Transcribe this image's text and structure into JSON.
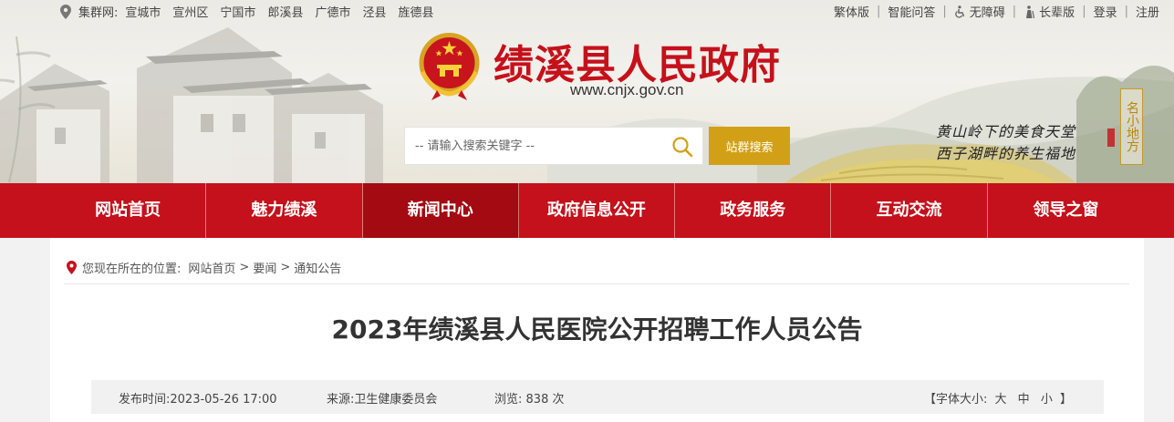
{
  "topbar": {
    "county_label": "集群网:",
    "counties": [
      "宣城市",
      "宣州区",
      "宁国市",
      "郎溪县",
      "广德市",
      "泾县",
      "旌德县"
    ],
    "links": {
      "traditional": "繁体版",
      "smart_qa": "智能问答",
      "accessibility": "无障碍",
      "elder": "长辈版",
      "login": "登录",
      "register": "注册"
    }
  },
  "header": {
    "title": "绩溪县人民政府",
    "url": "www.cnjx.gov.cn",
    "slogan_line1": "黄山岭下的美食天堂",
    "slogan_line2": "西子湖畔的养生福地",
    "seal_text": "名小地方"
  },
  "search": {
    "placeholder": "-- 请输入搜索关键字 --",
    "button_label": "站群搜索"
  },
  "nav": {
    "items": [
      {
        "label": "网站首页"
      },
      {
        "label": "魅力绩溪"
      },
      {
        "label": "新闻中心"
      },
      {
        "label": "政府信息公开"
      },
      {
        "label": "政务服务"
      },
      {
        "label": "互动交流"
      },
      {
        "label": "领导之窗"
      }
    ],
    "active_index": 2
  },
  "breadcrumb": {
    "prefix": "您现在所在的位置:",
    "items": [
      "网站首页",
      "要闻",
      "通知公告"
    ],
    "separator": ">"
  },
  "article": {
    "title": "2023年绩溪县人民医院公开招聘工作人员公告",
    "publish_label": "发布时间:",
    "publish_time": "2023-05-26 17:00",
    "source_label": "来源:",
    "source": "卫生健康委员会",
    "views_label": "浏览:",
    "views": "838 次",
    "font_size_label": "【字体大小:",
    "font_sizes": [
      "大",
      "中",
      "小"
    ],
    "font_size_close": "】"
  },
  "colors": {
    "brand_red": "#c4111b",
    "nav_active": "#a40a12",
    "search_gold": "#d2a016",
    "title_red": "#c5111b"
  },
  "icons": {
    "location": "map-pin-icon",
    "search": "magnifier-icon",
    "accessibility": "wheelchair-icon",
    "elder": "person-icon",
    "emblem": "national-emblem-icon"
  }
}
